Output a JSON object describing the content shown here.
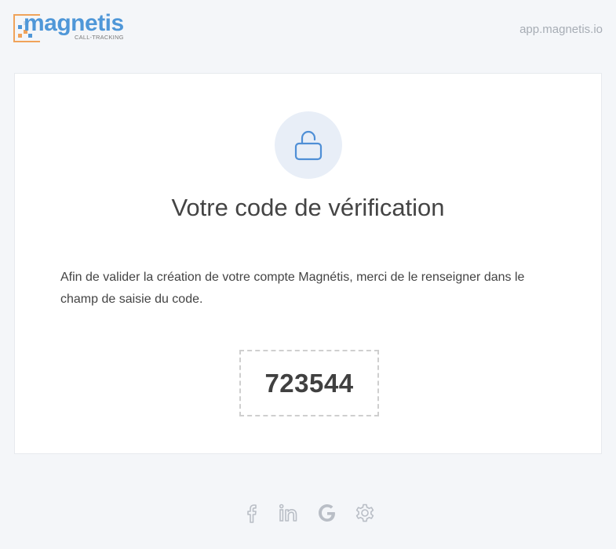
{
  "header": {
    "logo_word": "magnetis",
    "logo_sub": "CALL-TRACKING",
    "domain": "app.magnetis.io"
  },
  "card": {
    "icon": "unlock-icon",
    "title": "Votre code de vérification",
    "body": "Afin de valider la création de votre compte Magnétis, merci de le renseigner dans le champ de saisie du code.",
    "code": "723544"
  },
  "footer": {
    "icons": [
      "facebook-icon",
      "linkedin-icon",
      "google-icon",
      "gear-icon"
    ]
  },
  "colors": {
    "brand_blue": "#4f97d8",
    "brand_orange": "#f0a35a",
    "background": "#f4f6f9",
    "icon_gray": "#b9bec6"
  }
}
